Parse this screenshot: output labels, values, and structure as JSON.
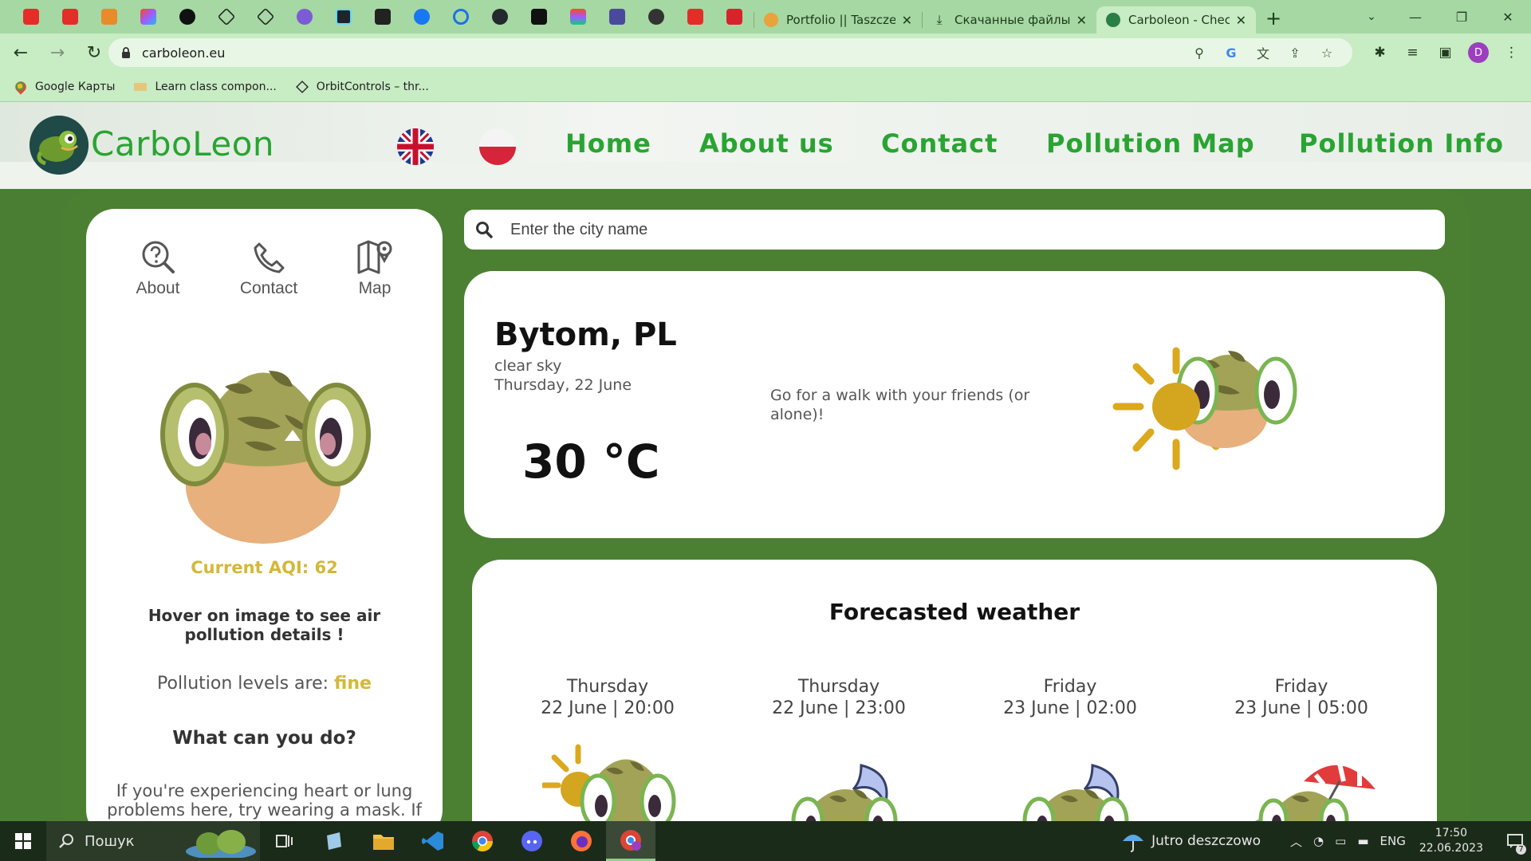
{
  "browser": {
    "tabs": [
      {
        "title": "Portfolio || TaszczerO",
        "icon_color": "#e8a33a"
      },
      {
        "title": "Скачанные файлы",
        "icon_color": "#1d3a1a"
      },
      {
        "title": "Carboleon - Check a",
        "icon_color": "#2a7f46",
        "active": true
      }
    ],
    "new_tab": "+",
    "url": "carboleon.eu",
    "bookmarks": [
      {
        "label": "Google Карты",
        "icon": "maps-pin-icon"
      },
      {
        "label": "Learn class compon...",
        "icon": "page-icon"
      },
      {
        "label": "OrbitControls – thr...",
        "icon": "threejs-icon"
      }
    ],
    "profile_initial": "D"
  },
  "site": {
    "brand": "CarboLeon",
    "nav": [
      "Home",
      "About us",
      "Contact",
      "Pollution Map",
      "Pollution Info"
    ],
    "quick_links": [
      "About",
      "Contact",
      "Map"
    ],
    "aqi_label": "Current AQI: 62",
    "hover_tip": "Hover on image to see air pollution details !",
    "levels_prefix": "Pollution levels are: ",
    "levels_value": "fine",
    "what_title": "What can you do?",
    "advice": "If you're experiencing heart or lung problems here, try wearing a mask. If the",
    "search_placeholder": "Enter the city name",
    "weather": {
      "city": "Bytom, PL",
      "description": "clear sky",
      "date": "Thursday, 22 June",
      "temperature": "30 °C",
      "tip": "Go for a walk with your friends (or alone)!"
    },
    "forecast_title": "Forecasted weather",
    "forecast": [
      {
        "day": "Thursday",
        "when": "22 June | 20:00",
        "icon": "sun"
      },
      {
        "day": "Thursday",
        "when": "22 June | 23:00",
        "icon": "moon"
      },
      {
        "day": "Friday",
        "when": "23 June | 02:00",
        "icon": "moon"
      },
      {
        "day": "Friday",
        "when": "23 June | 05:00",
        "icon": "umbrella"
      }
    ]
  },
  "taskbar": {
    "search_label": "Пошук",
    "weather_text": "Jutro deszczowo",
    "lang": "ENG",
    "time": "17:50",
    "date": "22.06.2023",
    "notifications": "7"
  },
  "colors": {
    "brand_green": "#29a432",
    "aqi_yellow": "#d4b838",
    "page_green": "#4b7f32"
  }
}
